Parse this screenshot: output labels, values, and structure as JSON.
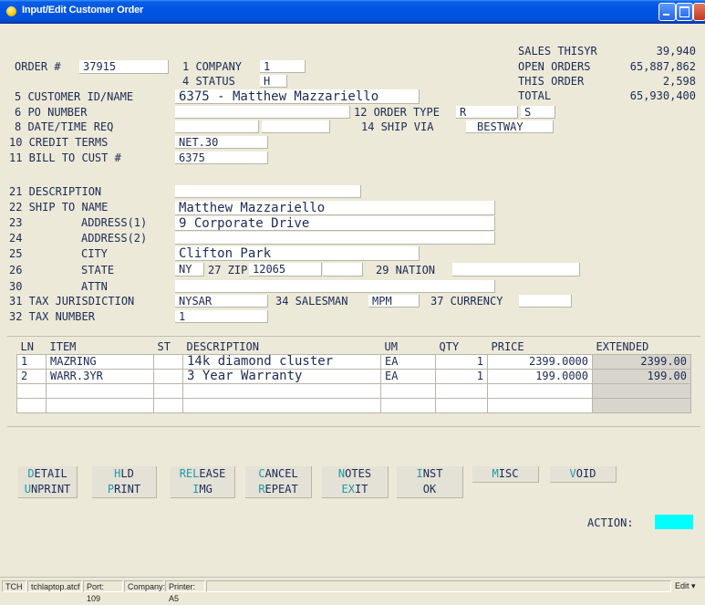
{
  "window": {
    "title": "Input/Edit Customer Order"
  },
  "summary": {
    "sales_thisyr": {
      "label": "SALES THISYR",
      "value": "39,940"
    },
    "open_orders": {
      "label": "OPEN ORDERS",
      "value": "65,887,862"
    },
    "this_order": {
      "label": "THIS ORDER",
      "value": "2,598"
    },
    "total": {
      "label": "TOTAL",
      "value": "65,930,400"
    }
  },
  "header": {
    "order_label": "ORDER #",
    "order_value": "37915",
    "company_label": "1 COMPANY",
    "company_value": "1",
    "status_label": "4 STATUS",
    "status_value": "H",
    "customer_label": "5 CUSTOMER ID/NAME",
    "customer_value": "6375 - Matthew Mazzariello",
    "po_label": "6 PO NUMBER",
    "po_value": "",
    "date_label": "8 DATE/TIME REQ",
    "date_value": "",
    "time_value": "",
    "order_type_label": "12 ORDER TYPE",
    "order_type_value": "R",
    "order_type_value2": "S",
    "ship_via_label": "14 SHIP VIA",
    "ship_via_value": "BESTWAY",
    "credit_label": "10 CREDIT TERMS",
    "credit_value": "NET.30",
    "billto_label": "11 BILL TO CUST #",
    "billto_value": "6375"
  },
  "shipto": {
    "desc_label": "21 DESCRIPTION",
    "desc_value": "",
    "name_label": "22 SHIP TO NAME",
    "name_value": "Matthew Mazzariello",
    "addr1_num": "23",
    "addr1_label": "ADDRESS(1)",
    "addr1_value": "9 Corporate Drive",
    "addr2_num": "24",
    "addr2_label": "ADDRESS(2)",
    "addr2_value": "",
    "city_num": "25",
    "city_label": "CITY",
    "city_value": "Clifton Park",
    "state_num": "26",
    "state_label": "STATE",
    "state_value": "NY",
    "zip_label": "27 ZIP",
    "zip_value": "12065",
    "zip_ext": "",
    "nation_label": "29 NATION",
    "nation_value": "",
    "attn_num": "30",
    "attn_label": "ATTN",
    "attn_value": "",
    "taxjur_label": "31 TAX JURISDICTION",
    "taxjur_value": "NYSAR",
    "salesman_label": "34 SALESMAN",
    "salesman_value": "MPM",
    "currency_label": "37 CURRENCY",
    "currency_value": "",
    "taxnum_label": "32 TAX NUMBER",
    "taxnum_value": "1"
  },
  "lines": {
    "columns": [
      "LN",
      "ITEM",
      "ST",
      "DESCRIPTION",
      "UM",
      "QTY",
      "PRICE",
      "EXTENDED"
    ],
    "rows": [
      [
        "1",
        "MAZRING",
        "",
        "14k diamond cluster",
        "EA",
        "1",
        "2399.0000",
        "2399.00"
      ],
      [
        "2",
        "WARR.3YR",
        "",
        "3 Year Warranty",
        "EA",
        "1",
        "199.0000",
        "199.00"
      ],
      [
        "",
        "",
        "",
        "",
        "",
        "",
        "",
        ""
      ],
      [
        "",
        "",
        "",
        "",
        "",
        "",
        "",
        ""
      ]
    ]
  },
  "buttons": [
    {
      "hk": "D",
      "rest": "ETAIL"
    },
    {
      "hk": "H",
      "rest": "LD"
    },
    {
      "hk": "REL",
      "rest": "EASE"
    },
    {
      "hk": "C",
      "rest": "ANCEL"
    },
    {
      "hk": "N",
      "rest": "OTES"
    },
    {
      "hk": "I",
      "rest": "NST"
    },
    {
      "hk": "M",
      "rest": "ISC"
    },
    {
      "hk": "V",
      "rest": "OID"
    },
    {
      "hk": "U",
      "rest": "NPRINT"
    },
    {
      "hk": "P",
      "rest": "RINT"
    },
    {
      "hk": "I",
      "rest": "MG"
    },
    {
      "hk": "R",
      "rest": "EPEAT"
    },
    {
      "hk": "EX",
      "rest": "IT"
    },
    {
      "hk": "",
      "rest": "OK"
    }
  ],
  "action_label": "ACTION:",
  "statusbar": {
    "tch": "TCH",
    "file": "tchlaptop.atcf",
    "port": "Port: 109",
    "company": "Company:",
    "printer": "Printer: A5",
    "edit": "Edit"
  },
  "colors": {
    "title_blue": "#0055e5",
    "hotkey": "#1e9aa8",
    "action": "#00ffff",
    "text": "#1c2a55"
  }
}
